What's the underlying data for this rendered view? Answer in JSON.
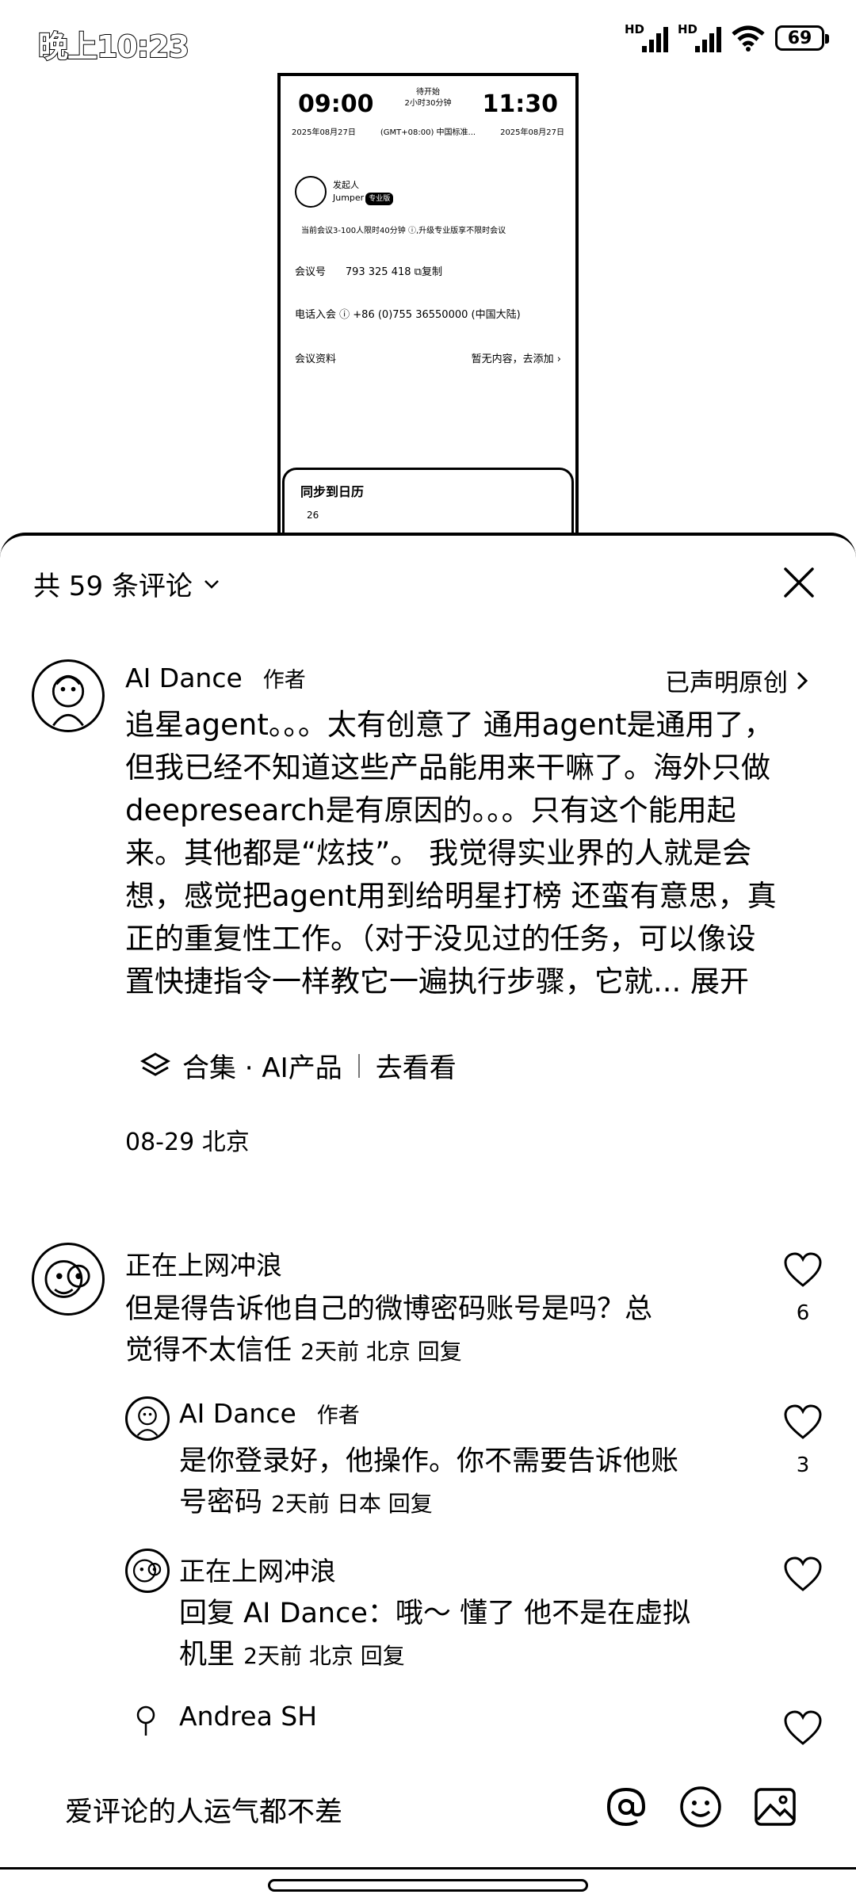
{
  "status_bar": {
    "time": "晚上10:23",
    "battery": "69",
    "signal_label": "HD"
  },
  "background_video": {
    "start_time": "09:00",
    "end_time": "11:30",
    "status": "待开始",
    "duration": "2小时30分钟",
    "start_date": "2025年08月27日",
    "timezone": "(GMT+08:00) 中国标准...",
    "end_date": "2025年08月27日",
    "host_label": "发起人",
    "host_name": "Jumper",
    "host_badge": "专业版",
    "limit_note": "当前会议3-100人限时40分钟 ⓘ,升级专业版享不限时会议",
    "meeting_id_label": "会议号",
    "meeting_id": "793 325 418",
    "copy_label": "复制",
    "phone_label": "电话入会 ⓘ",
    "phone_value": "+86 (0)755 36550000 (中国大陆)",
    "materials_label": "会议资料",
    "materials_value": "暂无内容，去添加",
    "sync_title": "同步到日历",
    "sync_sub": "26"
  },
  "sheet": {
    "title": "共 59 条评论"
  },
  "top_comment": {
    "name": "AI Dance",
    "author_tag": "作者",
    "original_claim": "已声明原创",
    "lines": [
      "追星agent。。。太有创意了 通用agent是通用了，",
      "但我已经不知道这些产品能用来干嘛了。海外只做",
      "deepresearch是有原因的。。。只有这个能用起",
      "来。其他都是“炫技”。 我觉得实业界的人就是会",
      "想，感觉把agent用到给明星打榜 还蛮有意思，真",
      "正的重复性工作。（对于没见过的任务，可以像设",
      "置快捷指令一样教它一遍执行步骤，它就... "
    ],
    "expand_label": "展开",
    "collection_label": "合集 · AI产品",
    "collection_action": "去看看",
    "date_location": "08-29 北京"
  },
  "comments": [
    {
      "name": "正在上网冲浪",
      "text_line1": "但是得告诉他自己的微博密码账号是吗？总",
      "text_line2": "觉得不太信任",
      "meta": "2天前 北京  回复",
      "likes": "6"
    },
    {
      "name": "AI Dance",
      "author_tag": "作者",
      "text_line1": "是你登录好，他操作。你不需要告诉他账",
      "text_line2": "号密码",
      "meta": "2天前 日本  回复",
      "likes": "3"
    },
    {
      "name": "正在上网冲浪",
      "text_line1": "回复 AI Dance：哦～ 懂了 他不是在虚拟",
      "text_line2": "机里",
      "meta": "2天前 北京  回复",
      "likes": ""
    },
    {
      "name": "Andrea SH",
      "likes": ""
    }
  ],
  "input_bar": {
    "placeholder": "爱评论的人运气都不差"
  }
}
